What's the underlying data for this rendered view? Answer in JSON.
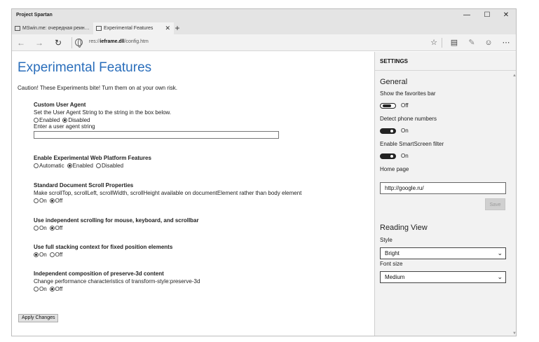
{
  "window": {
    "title": "Project Spartan",
    "controls": {
      "minimize": "—",
      "maximize": "☐",
      "close": "✕"
    }
  },
  "tabs": [
    {
      "label": "MSwin.me: очередная реин…",
      "active": false
    },
    {
      "label": "Experimental Features",
      "active": true,
      "close": "✕"
    }
  ],
  "new_tab": "+",
  "nav": {
    "back": "←",
    "forward": "→",
    "refresh": "↻",
    "address_prefix": "res://",
    "address_bold": "ieframe.dll",
    "address_suffix": "/config.htm",
    "icons": [
      "star-icon",
      "reading-list-icon",
      "web-note-icon",
      "smiley-icon",
      "more-icon"
    ]
  },
  "page": {
    "title": "Experimental Features",
    "caution": "Caution! These Experiments bite! Turn them on at your own risk.",
    "sections": [
      {
        "heading": "Custom User Agent",
        "description": "Set the User Agent String to the string in the box below.",
        "options": [
          "Enabled",
          "Disabled"
        ],
        "selected": 1,
        "input_label": "Enter a user agent string",
        "input_value": ""
      },
      {
        "heading": "Enable Experimental Web Platform Features",
        "options": [
          "Automatic",
          "Enabled",
          "Disabled"
        ],
        "selected": 1
      },
      {
        "heading": "Standard Document Scroll Properties",
        "description": "Make scrollTop, scrollLeft, scrollWidth, scrollHeight available on documentElement rather than body element",
        "options": [
          "On",
          "Off"
        ],
        "selected": 1
      },
      {
        "heading": "Use independent scrolling for mouse, keyboard, and scrollbar",
        "options": [
          "On",
          "Off"
        ],
        "selected": 1
      },
      {
        "heading": "Use full stacking context for fixed position elements",
        "options": [
          "On",
          "Off"
        ],
        "selected": 0
      },
      {
        "heading": "Independent composition of preserve-3d content",
        "description": "Change performance characteristics of transform-style:preserve-3d",
        "options": [
          "On",
          "Off"
        ],
        "selected": 1
      }
    ],
    "apply_label": "Apply Changes"
  },
  "settings": {
    "header": "SETTINGS",
    "general_heading": "General",
    "favorites_label": "Show the favorites bar",
    "favorites_state": "Off",
    "phone_label": "Detect phone numbers",
    "phone_state": "On",
    "smartscreen_label": "Enable SmartScreen filter",
    "smartscreen_state": "On",
    "home_label": "Home page",
    "home_value": "http://google.ru/",
    "save_label": "Save",
    "reading_heading": "Reading View",
    "style_label": "Style",
    "style_value": "Bright",
    "font_label": "Font size",
    "font_value": "Medium"
  },
  "colors": {
    "accent": "#2a6ebb",
    "chrome": "#e4e4e4",
    "toolbar": "#f2f2f2"
  }
}
